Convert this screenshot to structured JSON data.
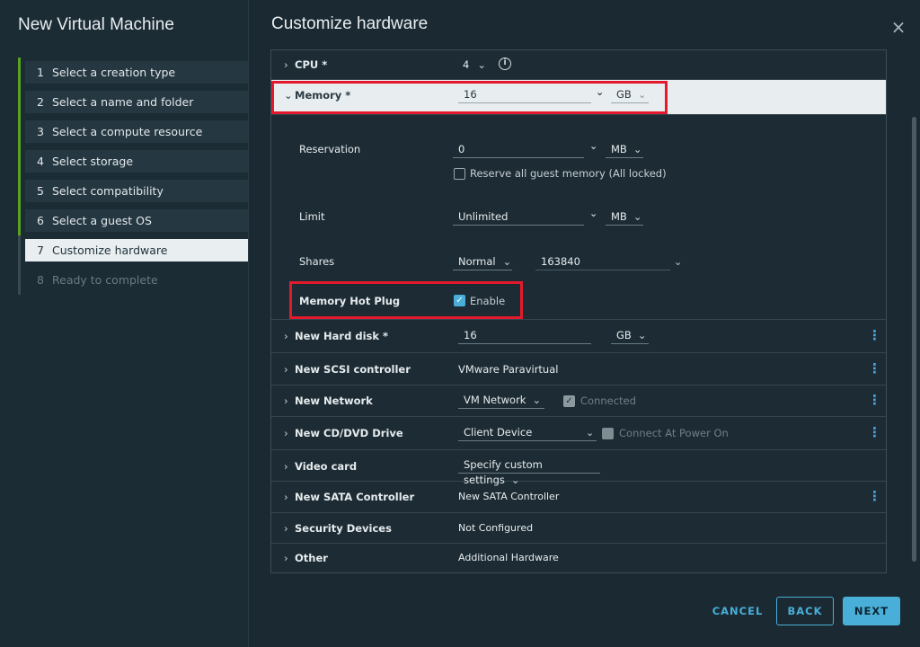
{
  "wizard": {
    "title": "New Virtual Machine"
  },
  "steps": [
    {
      "num": "1",
      "label": "Select a creation type"
    },
    {
      "num": "2",
      "label": "Select a name and folder"
    },
    {
      "num": "3",
      "label": "Select a compute resource"
    },
    {
      "num": "4",
      "label": "Select storage"
    },
    {
      "num": "5",
      "label": "Select compatibility"
    },
    {
      "num": "6",
      "label": "Select a guest OS"
    },
    {
      "num": "7",
      "label": "Customize hardware"
    },
    {
      "num": "8",
      "label": "Ready to complete"
    }
  ],
  "main": {
    "title": "Customize hardware",
    "close_icon": "×"
  },
  "hw": {
    "cpu": {
      "label": "CPU *",
      "value": "4",
      "info": "i"
    },
    "memory": {
      "label": "Memory *",
      "value": "16",
      "unit": "GB",
      "reservation": {
        "label": "Reservation",
        "value": "0",
        "unit": "MB",
        "checkbox_label": "Reserve all guest memory (All locked)"
      },
      "limit": {
        "label": "Limit",
        "value": "Unlimited",
        "unit": "MB"
      },
      "shares": {
        "label": "Shares",
        "level": "Normal",
        "value": "163840"
      },
      "hotplug": {
        "label": "Memory Hot Plug",
        "checkbox_label": "Enable",
        "checked": true
      }
    },
    "hard_disk": {
      "label": "New Hard disk *",
      "value": "16",
      "unit": "GB"
    },
    "scsi": {
      "label": "New SCSI controller",
      "value": "VMware Paravirtual"
    },
    "network": {
      "label": "New Network",
      "value": "VM Network",
      "checkbox_label": "Connected"
    },
    "cd": {
      "label": "New CD/DVD Drive",
      "value": "Client Device",
      "checkbox_label": "Connect At Power On"
    },
    "video": {
      "label": "Video card",
      "value": "Specify custom settings"
    },
    "sata": {
      "label": "New SATA Controller",
      "value": "New SATA Controller"
    },
    "security": {
      "label": "Security Devices",
      "value": "Not Configured"
    },
    "other": {
      "label": "Other",
      "value": "Additional Hardware"
    }
  },
  "footer": {
    "cancel": "CANCEL",
    "back": "BACK",
    "next": "NEXT"
  },
  "colors": {
    "accent": "#49afd9",
    "progress": "#5aa220",
    "highlight": "#e5192d"
  }
}
